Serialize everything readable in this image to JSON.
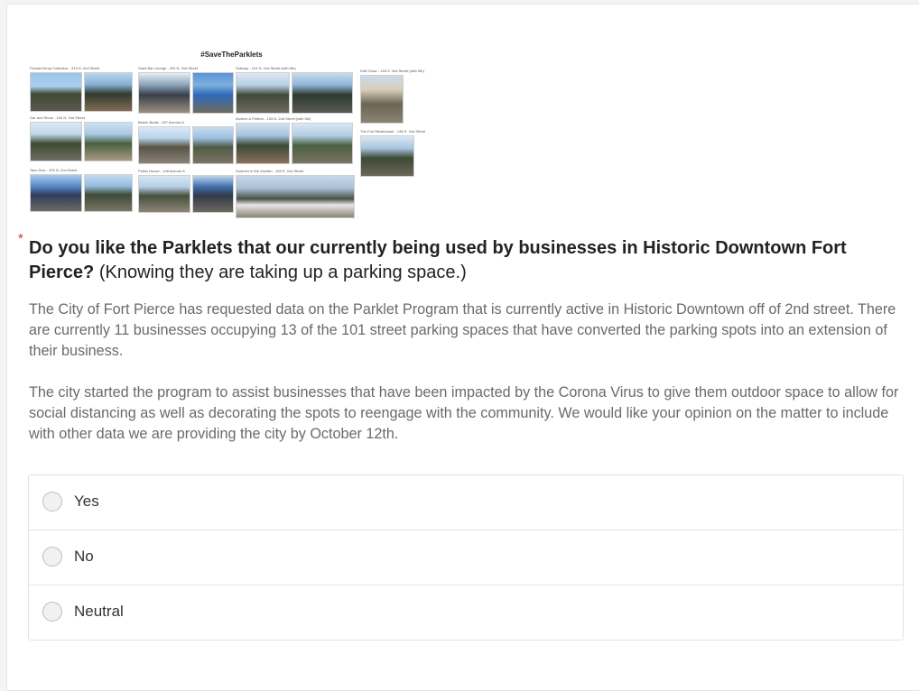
{
  "collage": {
    "title": "#SaveTheParklets",
    "captions": [
      "Florida Hemp Collective - 313 N. 2nd Street",
      "Sand Bar Lounge - 203 N. 2nd Street",
      "Subway - 104 N. 2nd Street (with 5th)",
      "Duff Close - 148 S. 2nd Street (with 5th)",
      "Oar and Stone - 150 N. 2nd Street",
      "Beach Boats - 207 Avenue A",
      "Archive & Potters - 133 N. 2nd Street (with 5th)",
      "The Fort Steakhouse - 148 S. 2nd Street",
      "Taco Dive - 200 N. 2nd Street",
      "Public House - 108 Avenue A",
      "Summer in the Garden - 108 S. 2nd Street"
    ]
  },
  "question": {
    "required_marker": "*",
    "title_bold": "Do you like the Parklets that our currently being used by businesses in Historic Downtown Fort Pierce?",
    "title_normal": " (Knowing they are taking up a parking space.)",
    "paragraphs": [
      "The City of Fort Pierce has requested data on the Parklet Program that is currently active in Historic Downtown off of 2nd street. There are currently 11 businesses occupying 13 of the 101 street parking spaces that have converted the parking spots into an extension of their business.",
      "The city started the program to assist businesses that have been impacted by the Corona Virus to give them outdoor space to allow for social distancing as well as decorating the spots to reengage with the community. We would like your opinion on the matter to include with other data we are providing the city by October 12th."
    ]
  },
  "choices": [
    {
      "label": "Yes"
    },
    {
      "label": "No"
    },
    {
      "label": "Neutral"
    }
  ]
}
